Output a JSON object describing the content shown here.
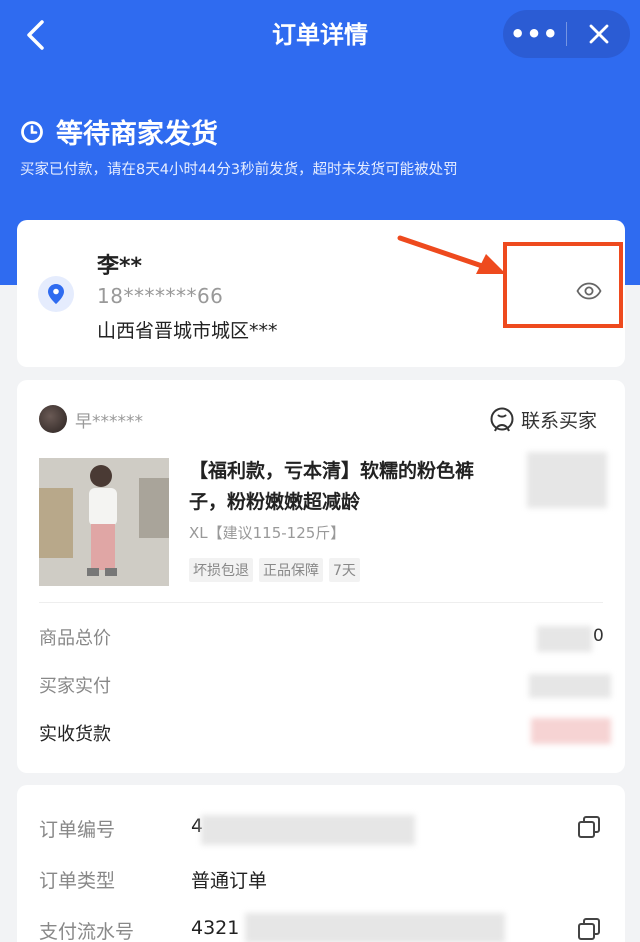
{
  "nav": {
    "title": "订单详情",
    "more": "•••"
  },
  "status": {
    "title": "等待商家发货",
    "desc": "买家已付款，请在8天4小时44分3秒前发货，超时未发货可能被处罚"
  },
  "address": {
    "name": "李**",
    "phone": "18*******66",
    "address": "山西省晋城市城区***"
  },
  "order": {
    "shop_name": "早******",
    "contact_label": "联系买家",
    "product_title": "【福利款，亏本清】软糯的粉色裤子，粉粉嫩嫩超减龄",
    "product_spec": "XL【建议115-125斤】",
    "tags": [
      "坏损包退",
      "正品保障",
      "7天"
    ],
    "goods_total_label": "商品总价",
    "goods_total_value": "0",
    "buyer_paid_label": "买家实付",
    "received_label": "实收货款"
  },
  "info": {
    "order_no_label": "订单编号",
    "order_no_value": "4",
    "order_type_label": "订单类型",
    "order_type_value": "普通订单",
    "payment_no_label": "支付流水号",
    "payment_no_value": "4321"
  },
  "colors": {
    "brand_blue": "#2f6bf0",
    "annotation_red": "#ee4a1e"
  },
  "icons": [
    "back-arrow-icon",
    "close-icon",
    "clock-icon",
    "location-pin-icon",
    "eye-icon",
    "contact-icon",
    "copy-icon"
  ]
}
